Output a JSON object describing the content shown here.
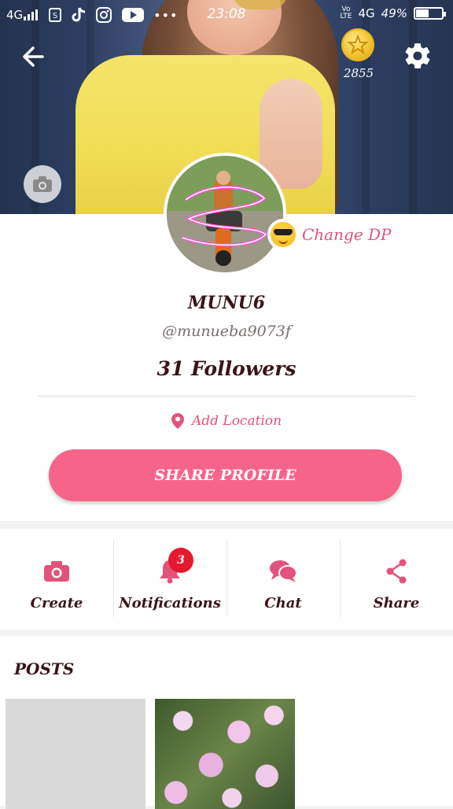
{
  "status_bar": {
    "network_left": "4G",
    "time": "23:08",
    "network_right": "4G",
    "battery": "49%",
    "battery_level": 0.49
  },
  "header": {
    "coins": "2855"
  },
  "profile": {
    "change_dp_label": "Change DP",
    "name": "MUNU6",
    "handle": "@munueba9073f",
    "followers": "31 Followers",
    "location_label": "Add Location",
    "share_button": "SHARE PROFILE"
  },
  "actions": [
    {
      "label": "Create",
      "icon": "camera-icon"
    },
    {
      "label": "Notifications",
      "icon": "bell-icon",
      "badge": "3"
    },
    {
      "label": "Chat",
      "icon": "chat-bubbles-icon"
    },
    {
      "label": "Share",
      "icon": "share-icon"
    }
  ],
  "posts": {
    "title": "POSTS"
  },
  "colors": {
    "accent": "#f76489",
    "accent_text": "#e3527a",
    "badge": "#e4192e",
    "dark_text": "#3a1418"
  }
}
